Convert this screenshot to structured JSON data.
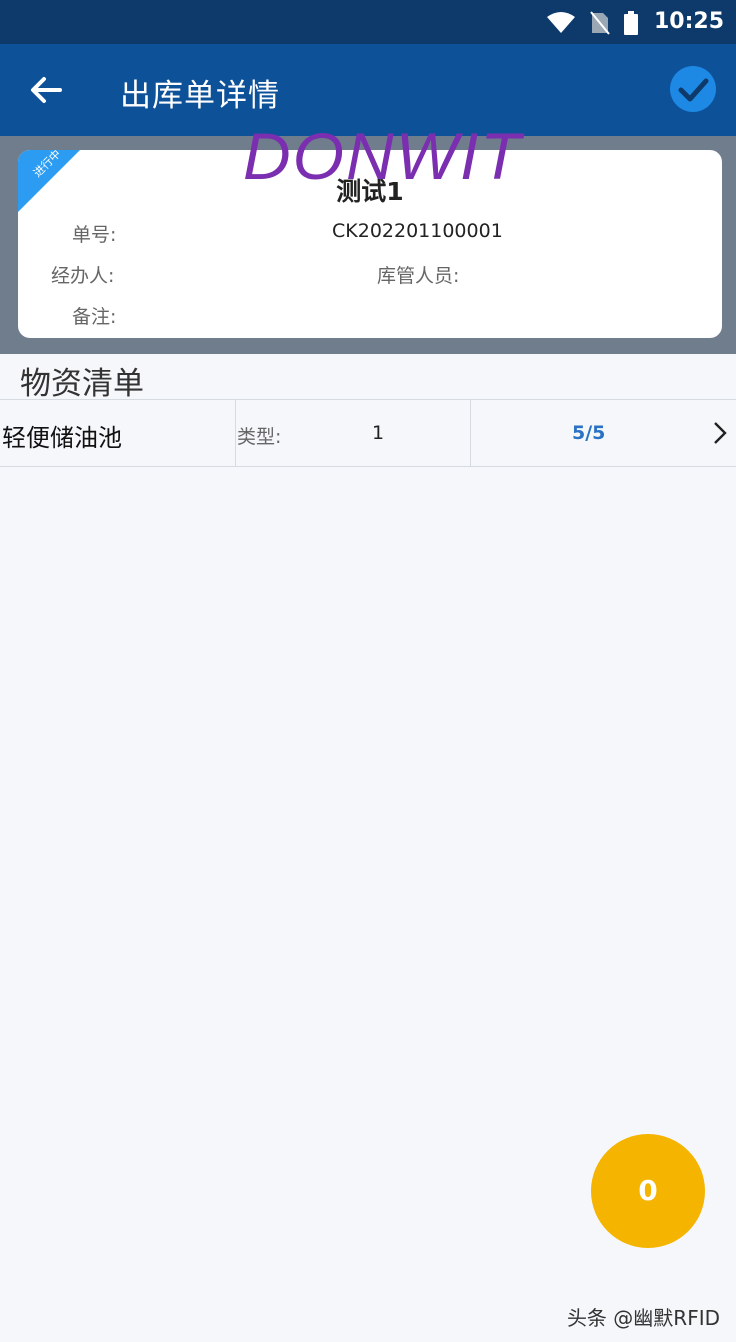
{
  "status_bar": {
    "time": "10:25",
    "icons": [
      "wifi-icon",
      "no-sim-icon",
      "battery-icon"
    ]
  },
  "app_bar": {
    "title": "出库单详情",
    "back_icon": "arrow-left-icon",
    "confirm_icon": "check-circle-icon",
    "color": "#0d5199",
    "confirm_color": "#1e88e5"
  },
  "order": {
    "title": "测试1",
    "status_ribbon": "进行中",
    "order_no_label": "单号:",
    "order_no": "CK202201100001",
    "handler_label": "经办人:",
    "handler": "",
    "keeper_label": "库管人员:",
    "keeper": "",
    "remark_label": "备注:",
    "remark": ""
  },
  "watermark": "DONWIT",
  "section_title": "物资清单",
  "items": [
    {
      "name": "轻便储油池",
      "type_label": "类型:",
      "type_value": "1",
      "quantity": "5/5"
    }
  ],
  "fab": {
    "count": "0",
    "color": "#f4b400"
  },
  "footer": "头条 @幽默RFID"
}
